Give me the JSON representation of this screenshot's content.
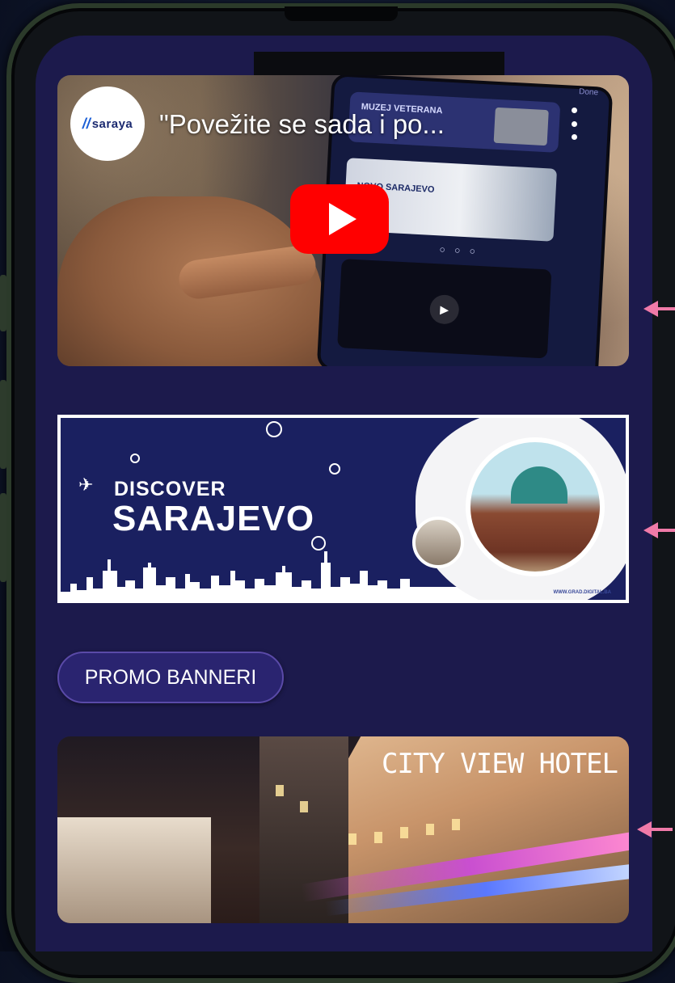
{
  "video": {
    "channel_name": "saraya",
    "title": "\"Povežite se sada i po...",
    "device_card_label": "MUZEJ VETERANA",
    "device_card_label2": "NOVO SARAJEVO",
    "device_done": "Done",
    "device_dots": "○ ○ ○",
    "play_icon": "youtube-play-icon",
    "more_icon": "more-vert-icon"
  },
  "banner": {
    "line1": "DISCOVER",
    "line2": "SARAJEVO",
    "url": "WWW.GRAD.DIGITAL.BA",
    "plane_glyph": "✈"
  },
  "promo": {
    "label": "PROMO BANNERI"
  },
  "hotel": {
    "title": "CITY VIEW HOTEL"
  },
  "colors": {
    "screen_bg": "#1c1a4c",
    "promo_bg": "#2a2470",
    "arrow": "#f07aa8",
    "youtube_red": "#ff0000"
  }
}
